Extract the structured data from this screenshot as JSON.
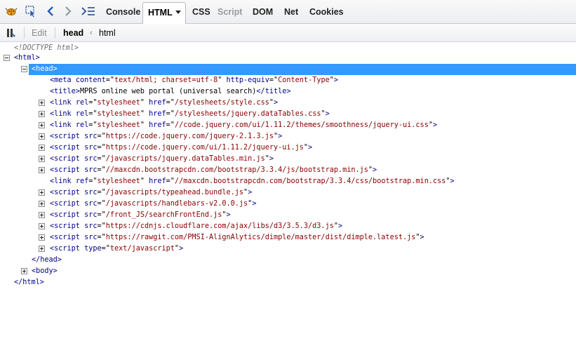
{
  "toolbar": {
    "tabs": [
      {
        "label": "Console",
        "state": "normal"
      },
      {
        "label": "HTML",
        "state": "selected"
      },
      {
        "label": "CSS",
        "state": "normal"
      },
      {
        "label": "Script",
        "state": "dim"
      },
      {
        "label": "DOM",
        "state": "normal"
      },
      {
        "label": "Net",
        "state": "normal"
      },
      {
        "label": "Cookies",
        "state": "normal"
      }
    ]
  },
  "subbar": {
    "edit_label": "Edit",
    "breadcrumb": [
      "head",
      "html"
    ]
  },
  "tree": {
    "doctype": "<!DOCTYPE html>",
    "html_open": "<html>",
    "head_open": "<head>",
    "meta": {
      "content": "text/html; charset=utf-8",
      "http_equiv": "Content-Type"
    },
    "title_text": "MPRS online web portal (universal search)",
    "links_1": [
      "/stylesheets/style.css",
      "/stylesheets/jquery.dataTables.css",
      "//code.jquery.com/ui/1.11.2/themes/smoothness/jquery-ui.css"
    ],
    "scripts_1": [
      "https://code.jquery.com/jquery-2.1.3.js",
      "https://code.jquery.com/ui/1.11.2/jquery-ui.js",
      "/javascripts/jquery.dataTables.min.js",
      "//maxcdn.bootstrapcdn.com/bootstrap/3.3.4/js/bootstrap.min.js"
    ],
    "link_ref": "//maxcdn.bootstrapcdn.com/bootstrap/3.3.4/css/bootstrap.min.css",
    "scripts_2": [
      "/javascripts/typeahead.bundle.js",
      "/javascripts/handlebars-v2.0.0.js",
      "/front_JS/searchFrontEnd.js",
      "https://cdnjs.cloudflare.com/ajax/libs/d3/3.5.3/d3.js",
      "https://rawgit.com/PMSI-AlignAlytics/dimple/master/dist/dimple.latest.js"
    ],
    "script_type": "text/javascript",
    "head_close": "</head>",
    "body_open": "<body>",
    "html_close": "</html>"
  },
  "colors": {
    "selection": "#3399ff",
    "tag": "#000088",
    "value": "#880000"
  }
}
